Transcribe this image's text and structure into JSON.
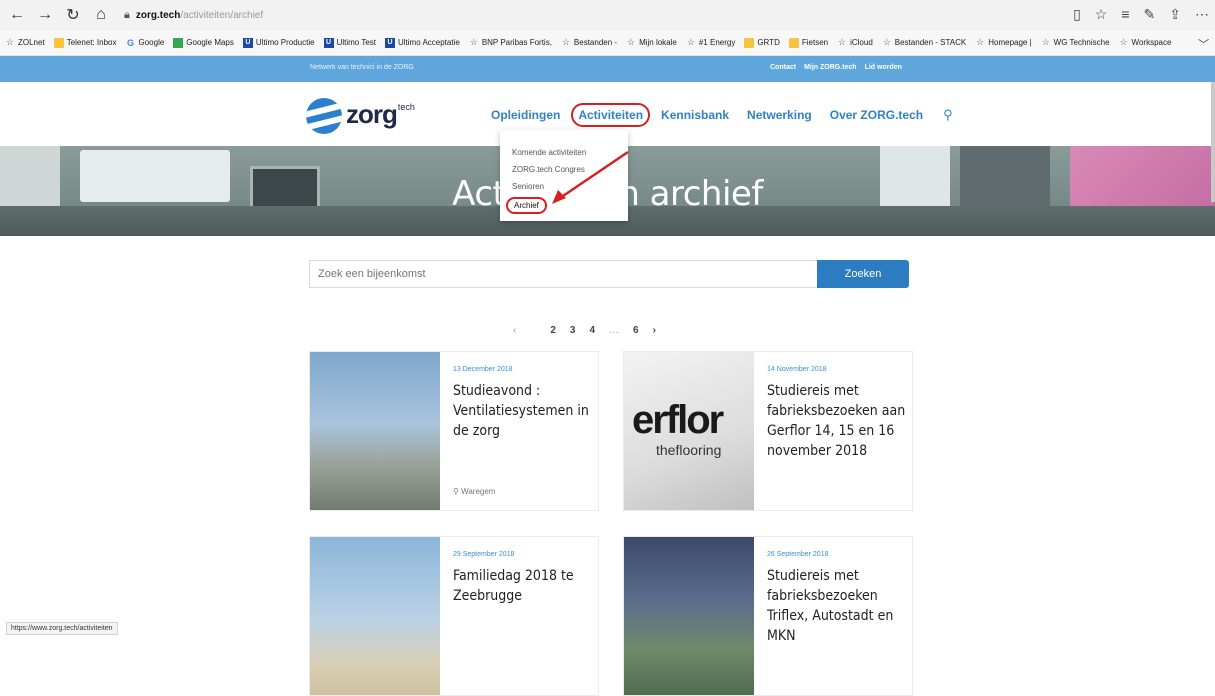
{
  "browser": {
    "url_host": "zorg.tech",
    "url_path": "/activiteiten/archief",
    "bookmarks": [
      {
        "label": "ZOLnet",
        "icon": "star"
      },
      {
        "label": "Telenet: Inbox",
        "icon": "folder"
      },
      {
        "label": "Google",
        "icon": "google"
      },
      {
        "label": "Google Maps",
        "icon": "maps"
      },
      {
        "label": "Ultimo Productie",
        "icon": "ultimo"
      },
      {
        "label": "Ultimo Test",
        "icon": "ultimo"
      },
      {
        "label": "Ultimo Acceptatie",
        "icon": "ultimo"
      },
      {
        "label": "BNP Paribas Fortis,",
        "icon": "star"
      },
      {
        "label": "Bestanden -",
        "icon": "star"
      },
      {
        "label": "Mijn lokale",
        "icon": "star"
      },
      {
        "label": "#1 Energy",
        "icon": "star"
      },
      {
        "label": "GRTD",
        "icon": "folder"
      },
      {
        "label": "Fietsen",
        "icon": "folder"
      },
      {
        "label": "iCloud",
        "icon": "star"
      },
      {
        "label": "Bestanden - STACK",
        "icon": "star"
      },
      {
        "label": "Homepage |",
        "icon": "star"
      },
      {
        "label": "WG Technische",
        "icon": "star"
      },
      {
        "label": "Workspace",
        "icon": "star"
      }
    ],
    "status_url": "https://www.zorg.tech/activiteiten"
  },
  "topstrip": {
    "tagline": "Netwerk van technici in de ZORG",
    "links": [
      "Contact",
      "Mijn ZORG.tech",
      "Lid worden"
    ]
  },
  "logo": {
    "word": "zorg",
    "sup": "tech"
  },
  "nav": {
    "items": [
      "Opleidingen",
      "Activiteiten",
      "Kennisbank",
      "Netwerking",
      "Over ZORG.tech"
    ]
  },
  "dropdown": {
    "items": [
      "Komende activiteiten",
      "ZORG.tech Congres",
      "Senioren",
      "Archief"
    ]
  },
  "hero": {
    "title": "Activiteiten archief"
  },
  "search": {
    "placeholder": "Zoek een bijeenkomst",
    "button": "Zoeken"
  },
  "pager": {
    "prev": "‹",
    "pages": [
      "2",
      "3",
      "4"
    ],
    "dots": "…",
    "last": "6",
    "next": "›"
  },
  "cards": [
    {
      "date": "13 December 2018",
      "title": "Studieavond : Ventilatiesystemen in de zorg",
      "location": "Waregem"
    },
    {
      "date": "14 November 2018",
      "title": "Studiereis met fabrieksbezoeken aan Gerflor 14, 15 en 16 november 2018",
      "location": ""
    },
    {
      "date": "29 September 2018",
      "title": "Familiedag 2018 te Zeebrugge",
      "location": ""
    },
    {
      "date": "26 September 2018",
      "title": "Studiereis met fabrieksbezoeken Triflex, Autostadt en MKN",
      "location": ""
    }
  ],
  "flag_image": {
    "word": "erflor",
    "sub": "theflooring"
  },
  "colors": {
    "accent": "#2e82c7",
    "annotation": "#d62020",
    "strip": "#5fa6dc"
  }
}
